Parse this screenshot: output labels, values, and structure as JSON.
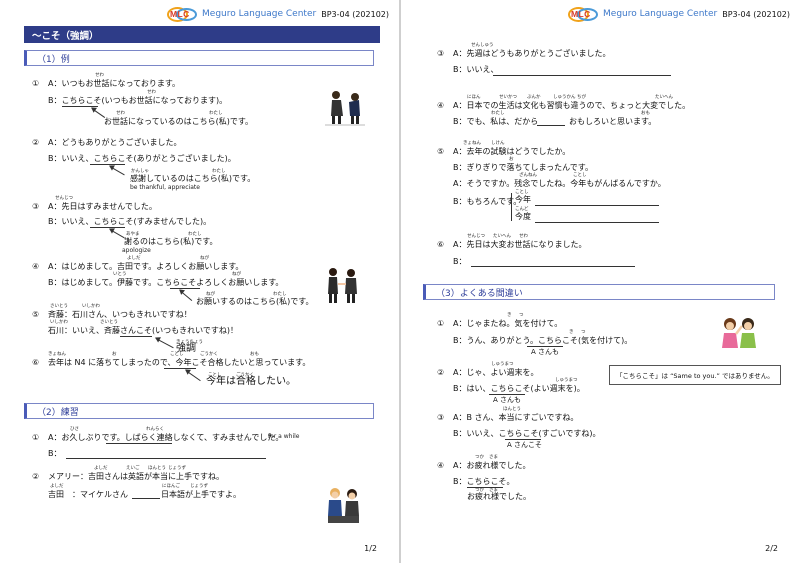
{
  "header": {
    "logo": "MLC",
    "org": "Meguro Language Center",
    "code": "BP3-04 (202102)"
  },
  "page1": {
    "title": "～こそ（強調）",
    "sec1": "（1）例",
    "ex1": {
      "num": "①",
      "a": "A：いつもお世話になっております。",
      "b": "B：こちらこそ(いつもお世話になっております)。",
      "c": "お世話になっているのはこちら(私)です。",
      "r1": "せわ",
      "r2": "せわ",
      "r3": "せわ",
      "r4": "わたし"
    },
    "ex2": {
      "num": "②",
      "a": "A：どうもありがとうございました。",
      "b": "B：いいえ、こちらこそ(ありがとうございました)。",
      "c": "感謝しているのはこちら(私)です。",
      "gloss": "be thankful, appreciate",
      "r1": "かんしゃ",
      "r2": "わたし"
    },
    "ex3": {
      "num": "③",
      "a": "A：先日はすみませんでした。",
      "b": "B：いいえ、こちらこそ(すみませんでした)。",
      "c": "謝るのはこちら(私)です。",
      "gloss": "apologize",
      "r1": "せんじつ",
      "r2": "あやま",
      "r3": "わたし"
    },
    "ex4": {
      "num": "④",
      "a": "A：はじめまして。吉田です。よろしくお願いします。",
      "b": "B：はじめまして。伊藤です。こちらこそよろしくお願いします。",
      "c": "お願いするのはこちら(私)です。",
      "r1": "よしだ",
      "r2": "ねが",
      "r3": "いとう",
      "r4": "ねが",
      "r5": "ねが",
      "r6": "わたし"
    },
    "ex5": {
      "num": "⑤",
      "a": "斉藤：石川さん、いつもきれいですね！",
      "b": "石川：いいえ、斉藤さんこそ(いつもきれいですね)！",
      "c": "強調",
      "r1": "さいとう",
      "r2": "いしかわ",
      "r3": "いしかわ",
      "r4": "さいとう",
      "r5": "きょうちょう"
    },
    "ex6": {
      "num": "⑥",
      "a": "去年は N4 に落ちてしまったので、今年こそ合格したいと思っています。",
      "c": "今年は合格したい。",
      "r1": "きょねん",
      "r2": "お",
      "r3": "ことし",
      "r4": "ごうかく",
      "r5": "おも",
      "r6": "ことし",
      "r7": "ごうかく"
    },
    "sec2": "（2）練習",
    "pr1": {
      "num": "①",
      "a": "A：お久しぶりです。しばらく連絡しなくて、すみませんでした。",
      "gloss": "for a while",
      "b": "B：",
      "r1": "ひさ",
      "r2": "れんらく"
    },
    "pr2": {
      "num": "②",
      "a": "メアリー：吉田さんは英語が本当に上手ですね。",
      "b1": "吉田　：マイケルさん",
      "b2": "日本語が上手ですよ。",
      "r1": "よしだ",
      "r2": "えいご",
      "r3": "ほんとう",
      "r4": "じょうず",
      "r5": "よしだ",
      "r6": "にほんご",
      "r7": "じょうず"
    },
    "pnum": "1/2"
  },
  "page2": {
    "q3": {
      "num": "③",
      "a": "A：先週はどうもありがとうございました。",
      "b": "B：いいえ、",
      "r1": "せんしゅう"
    },
    "q4": {
      "num": "④",
      "a": "A：日本での生活は文化も習慣も違うので、ちょっと大変でした。",
      "b1": "B：でも、私は、だから",
      "b2": "おもしろいと思います。",
      "r1": "にほん",
      "r2": "せいかつ",
      "r3": "ぶんか",
      "r4": "しゅうかん",
      "r5": "ちが",
      "r6": "たいへん",
      "r7": "わたし",
      "r8": "おも"
    },
    "q5": {
      "num": "⑤",
      "a": "A：去年の試験はどうでしたか。",
      "b": "B：ぎりぎりで落ちてしまったんです。",
      "c": "A：そうですか。残念でしたね。今年もがんばるんですか。",
      "d": "B：もちろんです。",
      "e1": "今年",
      "e2": "今度",
      "r1": "きょねん",
      "r2": "しけん",
      "r3": "お",
      "r4": "ざんねん",
      "r5": "ことし",
      "r6": "ことし",
      "r7": "こんど"
    },
    "q6": {
      "num": "⑥",
      "a": "A：先日は大変お世話になりました。",
      "b": "B：",
      "r1": "せんじつ",
      "r2": "たいへん",
      "r3": "せわ"
    },
    "sec3": "（3）よくある間違い",
    "m1": {
      "num": "①",
      "a": "A：じゃまたね。気を付けて。",
      "b": "B：うん、ありがとう。こちらこそ(気を付けて)。",
      "c": "A さんも",
      "r1": "き",
      "r2": "つ",
      "r3": "き",
      "r4": "つ"
    },
    "m2": {
      "num": "②",
      "a": "A：じゃ、よい週末を。",
      "b": "B：はい、こちらこそ(よい週末を)。",
      "c": "A さんも",
      "r1": "しゅうまつ",
      "r2": "しゅうまつ"
    },
    "note": "「こちらこそ」は “Same to you.” ではありません。",
    "m3": {
      "num": "③",
      "a": "A：B さん、本当にすごいですね。",
      "b": "B：いいえ、こちらこそ(すごいですね)。",
      "c": "A さんこそ",
      "r1": "ほんとう"
    },
    "m4": {
      "num": "④",
      "a": "A：お疲れ様でした。",
      "b": "B：こちらこそ。",
      "c": "お疲れ様でした。",
      "r1": "つか",
      "r2": "さま",
      "r3": "つか",
      "r4": "さま"
    },
    "pnum": "2/2"
  },
  "colors": {
    "title_bg": "#2e3c88",
    "section_border": "#7a86c7",
    "org_text": "#3d78c9",
    "logo_text": "#d63b2a"
  },
  "icons": [
    "bowing-people-illustration",
    "business-greeting-illustration",
    "chatting-men-illustration",
    "waving-women-illustration"
  ]
}
